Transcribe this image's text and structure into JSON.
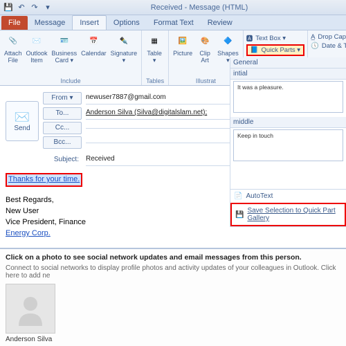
{
  "window": {
    "title": "Received - Message (HTML)"
  },
  "tabs": {
    "file": "File",
    "message": "Message",
    "insert": "Insert",
    "options": "Options",
    "format": "Format Text",
    "review": "Review"
  },
  "ribbon": {
    "include": {
      "attach_file": "Attach\nFile",
      "outlook_item": "Outlook\nItem",
      "business_card": "Business\nCard ▾",
      "calendar": "Calendar",
      "signature": "Signature\n▾",
      "group": "Include"
    },
    "tables": {
      "table": "Table\n▾",
      "group": "Tables"
    },
    "illus": {
      "picture": "Picture",
      "clipart": "Clip\nArt",
      "shapes": "Shapes\n▾",
      "group": "Illustrat"
    },
    "text": {
      "textbox": "Text Box ▾",
      "quickparts": "Quick Parts ▾",
      "dropcap": "Drop Cap ▾",
      "datetime": "Date & Time"
    }
  },
  "compose": {
    "send": "Send",
    "from_btn": "From ▾",
    "from_val": "newuser7887@gmail.com",
    "to_btn": "To...",
    "to_val": "Anderson Silva (Silva@digitalslam.net);",
    "cc_btn": "Cc...",
    "cc_val": "",
    "bcc_btn": "Bcc...",
    "bcc_val": "",
    "subject_lbl": "Subject:",
    "subject_val": "Received"
  },
  "body": {
    "selected": "Thanks for your time.",
    "sig1": "Best Regards,",
    "sig2": "New User",
    "sig3": "Vice President, Finance",
    "sig4": "Energy Corp."
  },
  "quickparts_pane": {
    "cat_general": "General",
    "cat_initial": "intial",
    "item_initial": "It was a pleasure.",
    "cat_middle": "middle",
    "item_middle": "Keep in touch",
    "autotext": "AutoText",
    "save": "Save Selection to Quick Part Gallery"
  },
  "social": {
    "hint": "Click on a photo to see social network updates and email messages from this person.",
    "sub": "Connect to social networks to display profile photos and activity updates of your colleagues in Outlook. Click here to add ne",
    "name": "Anderson Silva"
  }
}
